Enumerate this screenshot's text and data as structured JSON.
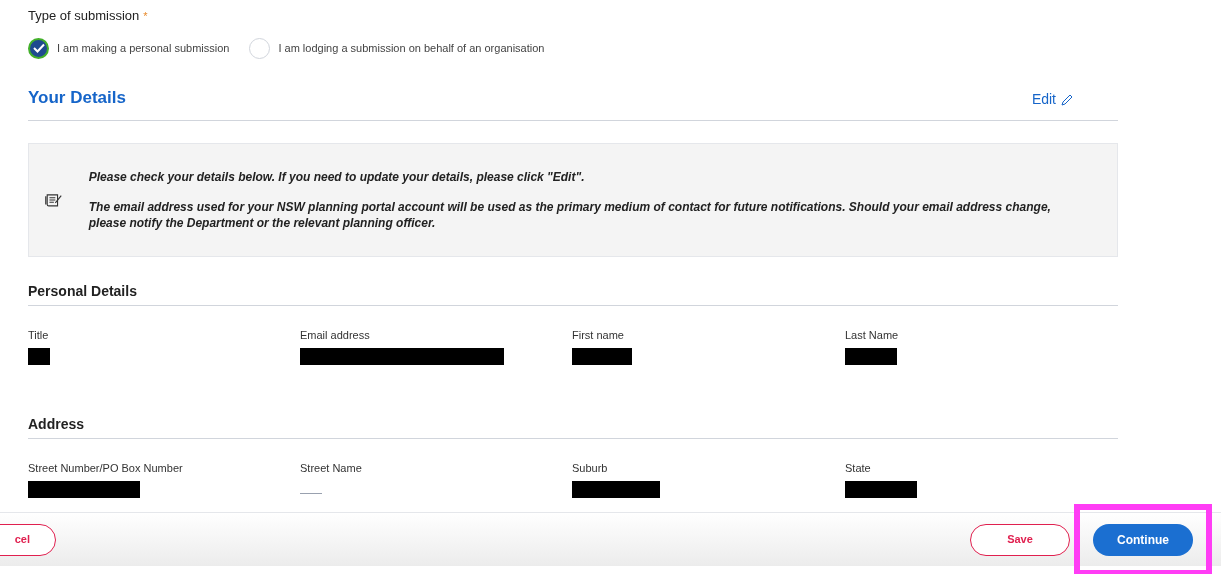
{
  "submission_type": {
    "label": "Type of submission",
    "required_mark": "*",
    "options": [
      {
        "label": "I am making a personal submission",
        "selected": true
      },
      {
        "label": "I am lodging a submission on behalf of an organisation",
        "selected": false
      }
    ]
  },
  "your_details": {
    "title": "Your Details",
    "edit_link": "Edit",
    "notice": [
      "Please check your details below. If you need to update your details, please click \"Edit\".",
      "The email address used for your NSW planning portal account will be used as the primary medium of contact for future notifications. Should your email address change, please notify the Department or the relevant planning officer."
    ]
  },
  "sections": [
    {
      "title": "Personal Details",
      "fields": [
        {
          "label": "Title",
          "kind": "redacted"
        },
        {
          "label": "Email address",
          "kind": "redacted"
        },
        {
          "label": "First name",
          "kind": "redacted"
        },
        {
          "label": "Last Name",
          "kind": "redacted"
        }
      ]
    },
    {
      "title": "Address",
      "fields": [
        {
          "label": "Street Number/PO Box Number",
          "kind": "redacted"
        },
        {
          "label": "Street Name",
          "kind": "blank"
        },
        {
          "label": "Suburb",
          "kind": "redacted"
        },
        {
          "label": "State",
          "kind": "redacted"
        }
      ]
    }
  ],
  "footer": {
    "cancel": "cel",
    "save": "Save",
    "continue": {
      "label": "Continue",
      "highlighted": true
    }
  }
}
